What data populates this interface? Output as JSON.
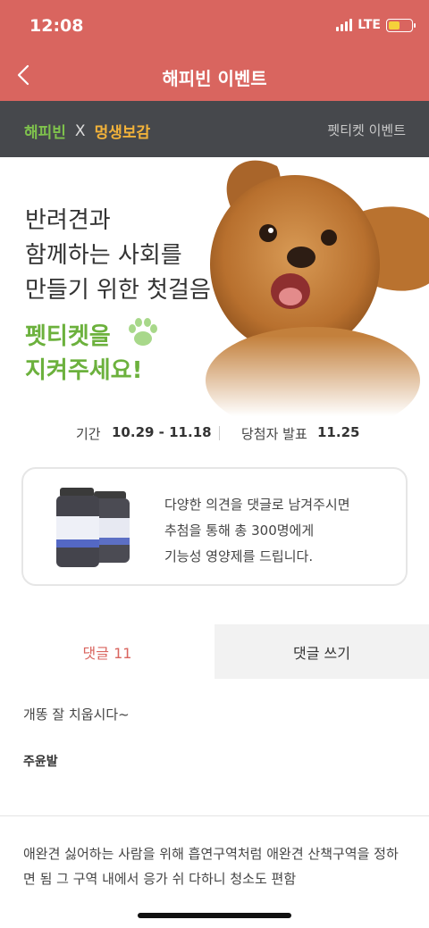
{
  "status": {
    "time": "12:08",
    "network": "LTE"
  },
  "header": {
    "title": "해피빈 이벤트",
    "back_icon": "chevron-left-icon"
  },
  "subbar": {
    "brand_a": "해피빈",
    "brand_x": "X",
    "brand_b": "멍생보감",
    "right_label": "펫티켓 이벤트"
  },
  "hero": {
    "line1": "반려견과",
    "line2": "함께하는 사회를",
    "line3": "만들기 위한 첫걸음",
    "green1": "펫티켓을",
    "green2": "지켜주세요!"
  },
  "period": {
    "label1": "기간",
    "value1": "10.29 - 11.18",
    "label2": "당첨자 발표",
    "value2": "11.25"
  },
  "prize": {
    "line1": "다양한 의견을 댓글로 남겨주시면",
    "line2": "추첨을 통해 총 300명에게",
    "line3": "기능성 영양제를 드립니다."
  },
  "tabs": {
    "comments": "댓글 11",
    "write": "댓글 쓰기"
  },
  "comments": [
    {
      "text": "개똥 잘 치웁시다~",
      "author": "주윤발"
    },
    {
      "text": "애완견 싫어하는 사람을 위해 흡연구역처럼 애완견 산책구역을 정하면 됨 그 구역 내에서 응가 쉬 다하니 청소도 편함"
    }
  ],
  "colors": {
    "header": "#d9655f",
    "subbar": "#46484c",
    "green": "#6cb13d",
    "brand_orange": "#f2b23a"
  }
}
